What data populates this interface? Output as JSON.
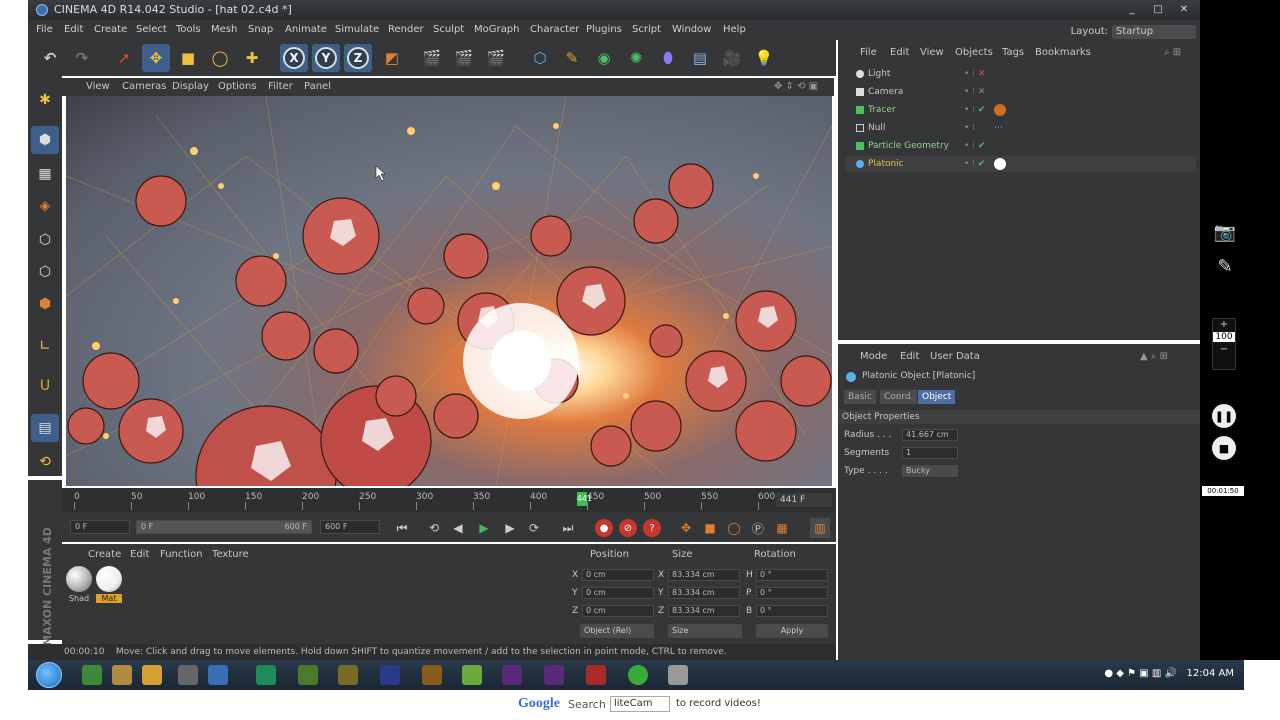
{
  "window": {
    "title": "CINEMA 4D R14.042 Studio - [hat 02.c4d *]",
    "controls": [
      "_",
      "□",
      "✕"
    ]
  },
  "menu": [
    "File",
    "Edit",
    "Create",
    "Select",
    "Tools",
    "Mesh",
    "Snap",
    "Animate",
    "Simulate",
    "Render",
    "Sculpt",
    "MoGraph",
    "Character",
    "Plugins",
    "Script",
    "Window",
    "Help"
  ],
  "layout": {
    "label": "Layout:",
    "value": "Startup"
  },
  "axis_labels": [
    "X",
    "Y",
    "Z"
  ],
  "viewport_menu": [
    "View",
    "Cameras",
    "Display",
    "Options",
    "Filter",
    "Panel"
  ],
  "timeline": {
    "ticks": [
      "0",
      "50",
      "100",
      "150",
      "200",
      "250",
      "300",
      "350",
      "400",
      "450",
      "500",
      "550",
      "600"
    ],
    "current": "441",
    "frame_field": "441 F",
    "progress": 0.735
  },
  "transport": {
    "start": "0 F",
    "range_start": "0 F",
    "range_end": "600 F",
    "end": "600 F"
  },
  "materials": {
    "menu": [
      "Create",
      "Edit",
      "Function",
      "Texture"
    ],
    "items": [
      "Shad",
      "Mat"
    ]
  },
  "coords": {
    "headers": [
      "Position",
      "Size",
      "Rotation"
    ],
    "rows": [
      {
        "axis": "X",
        "pos": "0 cm",
        "saxis": "X",
        "size": "83.334 cm",
        "raxis": "H",
        "rot": "0 °"
      },
      {
        "axis": "Y",
        "pos": "0 cm",
        "saxis": "Y",
        "size": "83.334 cm",
        "raxis": "P",
        "rot": "0 °"
      },
      {
        "axis": "Z",
        "pos": "0 cm",
        "saxis": "Z",
        "size": "83.334 cm",
        "raxis": "B",
        "rot": "0 °"
      }
    ],
    "mode": "Object (Rel)",
    "size_mode": "Size",
    "apply": "Apply"
  },
  "status": {
    "time": "00:00:10",
    "text": "Move: Click and drag to move elements. Hold down SHIFT to quantize movement / add to the selection in point mode, CTRL to remove."
  },
  "objects": {
    "menu": [
      "File",
      "Edit",
      "View",
      "Objects",
      "Tags",
      "Bookmarks"
    ],
    "items": [
      {
        "name": "Light",
        "color": "#c8c8c8"
      },
      {
        "name": "Camera",
        "color": "#c8c8c8"
      },
      {
        "name": "Tracer",
        "color": "#8fd18f"
      },
      {
        "name": "Null",
        "color": "#c8c8c8"
      },
      {
        "name": "Particle Geometry",
        "color": "#8fd18f"
      },
      {
        "name": "Platonic",
        "color": "#e6c04a"
      }
    ]
  },
  "attributes": {
    "menu": [
      "Mode",
      "Edit",
      "User Data"
    ],
    "object_title": "Platonic Object [Platonic]",
    "tabs": [
      "Basic",
      "Coord.",
      "Object"
    ],
    "section": "Object Properties",
    "props": [
      {
        "label": "Radius . . .",
        "value": "41.667 cm"
      },
      {
        "label": "Segments",
        "value": "1"
      },
      {
        "label": "Type . . . .",
        "value": "Bucky"
      }
    ]
  },
  "recorder": {
    "zoom_plus": "+",
    "zoom_value": "100",
    "zoom_minus": "−",
    "timer": "00:01:50"
  },
  "taskbar": {
    "clock": "12:04 AM"
  },
  "promo": {
    "google": "Google",
    "search": "Search",
    "box": "liteCam",
    "tail": "to record videos!"
  },
  "colors": {
    "accent": "#3d5f8a",
    "play": "#3cbf57",
    "record": "#c9362f"
  }
}
